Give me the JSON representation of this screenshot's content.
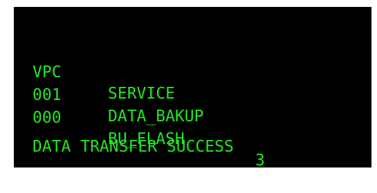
{
  "terminal": {
    "text_color": "#22e622",
    "background_color": "#000000",
    "header": {
      "vpc": "VPC",
      "service": "SERVICE"
    },
    "rows": [
      {
        "vpc": "001",
        "service": "DATA_BAKUP",
        "count": ""
      },
      {
        "vpc": "000",
        "service": "BU_FLASH",
        "count": "3"
      }
    ],
    "status_message": "DATA TRANSFER SUCCESS"
  }
}
